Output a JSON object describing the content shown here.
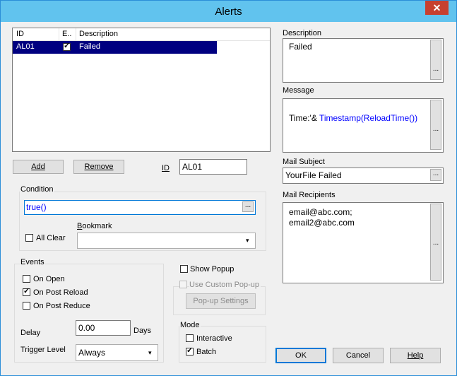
{
  "window": {
    "title": "Alerts",
    "close_glyph": "✕"
  },
  "list": {
    "headers": [
      "ID",
      "E..",
      "Description"
    ],
    "rows": [
      {
        "id": "AL01",
        "enabled": true,
        "description": "Failed"
      }
    ]
  },
  "buttons": {
    "add": "Add",
    "remove": "Remove",
    "ok": "OK",
    "cancel": "Cancel",
    "help": "Help",
    "popup_settings": "Pop-up Settings",
    "ellipsis": "..."
  },
  "id_field": {
    "label": "ID",
    "value": "AL01"
  },
  "condition": {
    "label": "Condition",
    "value": "true()",
    "all_clear_label": "All Clear",
    "bookmark_label": "Bookmark",
    "bookmark_value": ""
  },
  "events": {
    "label": "Events",
    "items": [
      {
        "label": "On Open",
        "checked": false
      },
      {
        "label": "On Post Reload",
        "checked": true
      },
      {
        "label": "On Post Reduce",
        "checked": false
      }
    ],
    "delay_label": "Delay",
    "delay_value": "0.00",
    "delay_unit": "Days",
    "trigger_label": "Trigger Level",
    "trigger_value": "Always"
  },
  "popup": {
    "show_label": "Show Popup",
    "custom_label": "Use Custom Pop-up"
  },
  "mode": {
    "label": "Mode",
    "items": [
      {
        "label": "Interactive",
        "checked": false
      },
      {
        "label": "Batch",
        "checked": true
      }
    ]
  },
  "right": {
    "description_label": "Description",
    "description_value": "Failed",
    "message_label": "Message",
    "message_prefix": "Time:'& ",
    "message_func": "Timestamp(ReloadTime())",
    "mail_subject_label": "Mail Subject",
    "mail_subject_value": "YourFile Failed",
    "mail_recipients_label": "Mail Recipients",
    "recipients": [
      "email@abc.com;",
      "email2@abc.com"
    ]
  },
  "colors": {
    "accent": "#0078d7",
    "selection": "#000080",
    "title_bar": "#61c3ee",
    "close": "#c7402f",
    "func_blue": "#0000ff"
  }
}
